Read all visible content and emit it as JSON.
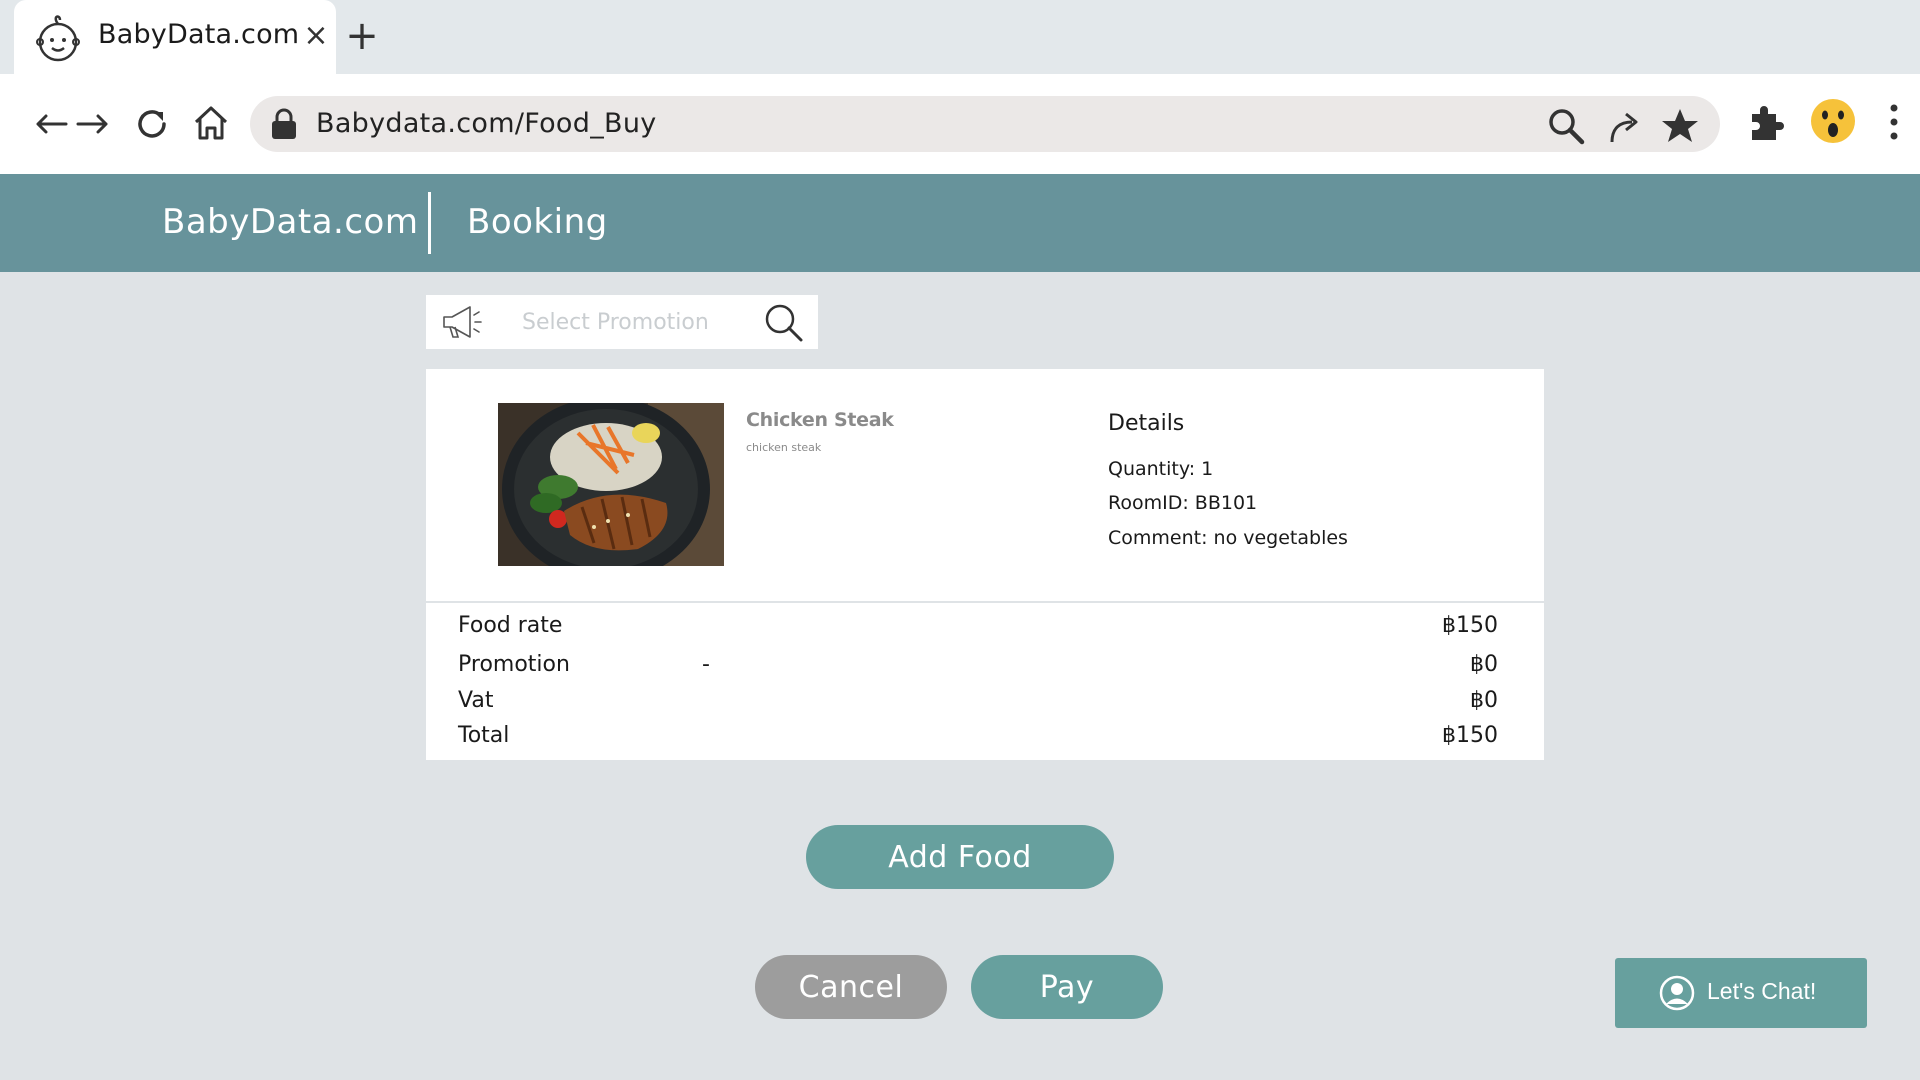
{
  "browser": {
    "tab_title": "BabyData.com",
    "tab_close": "×",
    "new_tab": "+",
    "url": "Babydata.com/Food_Buy"
  },
  "site": {
    "brand": "BabyData.com",
    "section": "Booking"
  },
  "promotion": {
    "placeholder": "Select Promotion",
    "value": ""
  },
  "order": {
    "food_name": "Chicken Steak",
    "food_description": "chicken steak",
    "details_title": "Details",
    "details": [
      "Quantity: 1",
      "RoomID: BB101",
      "Comment: no vegetables"
    ]
  },
  "summary": {
    "food_rate_label": "Food rate",
    "food_rate_value": "฿150",
    "promotion_label": "Promotion",
    "promotion_selected": "-",
    "promotion_value": "฿0",
    "vat_label": "Vat",
    "vat_value": "฿0",
    "total_label": "Total",
    "total_value": "฿150"
  },
  "buttons": {
    "add_food": "Add Food",
    "cancel": "Cancel",
    "pay": "Pay",
    "chat": "Let's Chat!"
  },
  "colors": {
    "header": "#67939b",
    "primary_button": "#67a09e",
    "cancel_button": "#9d9d9d",
    "page_background": "#dfe3e6"
  },
  "icons": {
    "favicon": "baby-face-icon",
    "back": "arrow-left-icon",
    "forward": "arrow-right-icon",
    "reload": "reload-icon",
    "home": "home-icon",
    "lock": "lock-icon",
    "omni_search": "search-icon",
    "share": "share-icon",
    "bookmark": "star-icon",
    "extensions": "puzzle-icon",
    "profile": "surprised-emoji-icon",
    "menu": "kebab-menu-icon",
    "promo": "megaphone-icon",
    "promo_search": "search-icon",
    "chat": "user-circle-icon"
  }
}
